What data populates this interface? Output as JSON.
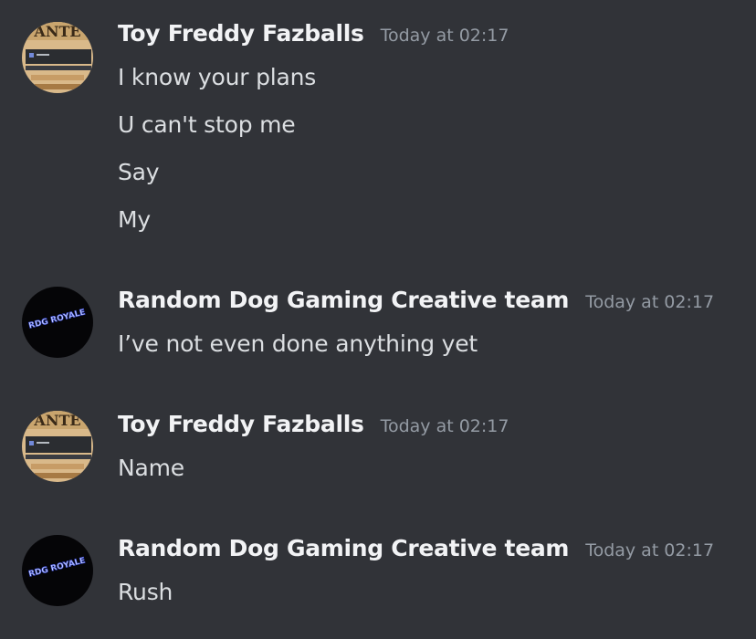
{
  "colors": {
    "background": "#313338",
    "username": "#f2f3f5",
    "timestamp": "#949ba4",
    "message_text": "#dbdee1"
  },
  "messages": [
    {
      "author": "Toy Freddy Fazballs",
      "time": "Today at 02:17",
      "avatar_icon": "wanted-poster-avatar",
      "lines": [
        "I know your plans",
        "U can't stop me",
        "Say",
        "My"
      ]
    },
    {
      "author": "Random Dog Gaming Creative team",
      "time": "Today at 02:17",
      "avatar_icon": "rdg-royale-logo-avatar",
      "avatar_text": "RDG ROYALE",
      "lines": [
        "I’ve not even done anything yet"
      ]
    },
    {
      "author": "Toy Freddy Fazballs",
      "time": "Today at 02:17",
      "avatar_icon": "wanted-poster-avatar",
      "lines": [
        "Name"
      ]
    },
    {
      "author": "Random Dog Gaming Creative team",
      "time": "Today at 02:17",
      "avatar_icon": "rdg-royale-logo-avatar",
      "avatar_text": "RDG ROYALE",
      "lines": [
        "Rush"
      ]
    }
  ]
}
